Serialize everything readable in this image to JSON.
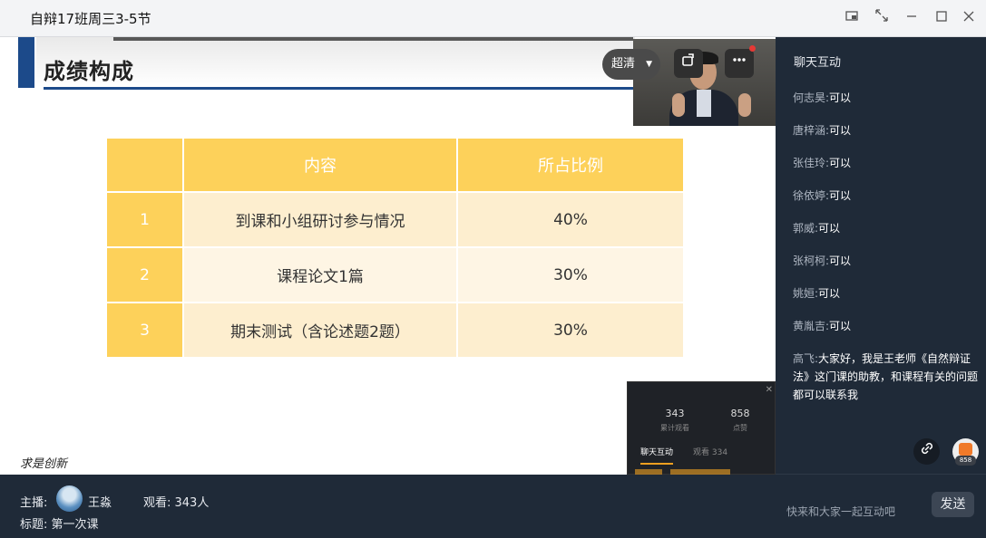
{
  "window": {
    "title": "自辩17班周三3-5节",
    "controls": [
      "pin-icon",
      "fullscreen-icon",
      "minimize-icon",
      "maximize-icon",
      "close-icon"
    ]
  },
  "slide": {
    "heading": "成绩构成",
    "table": {
      "headers": [
        "",
        "内容",
        "所占比例"
      ],
      "rows": [
        {
          "num": "1",
          "content": "到课和小组研讨参与情况",
          "ratio": "40%"
        },
        {
          "num": "2",
          "content": "课程论文1篇",
          "ratio": "30%"
        },
        {
          "num": "3",
          "content": "期末测试（含论述题2题）",
          "ratio": "30%"
        }
      ]
    },
    "signature": "求是创新",
    "colors": {
      "header": "#fdd15a",
      "row_light": "#fdeecf",
      "row_lighter": "#fef5e4",
      "accent": "#1c4a8a"
    }
  },
  "player": {
    "quality_label": "超清",
    "rotate_icon": "rotate-icon",
    "more_icon": "more-icon"
  },
  "mini_panel": {
    "stat1_value": "343",
    "stat1_label": "累计观看",
    "stat2_value": "858",
    "stat2_label": "点赞",
    "tab_chat": "聊天互动",
    "tab_viewers": "观看 334"
  },
  "info": {
    "host_label": "主播:",
    "host_name": "王淼",
    "viewers": "观看: 343人",
    "subject": "标题: 第一次课"
  },
  "chat": {
    "title": "聊天互动",
    "messages": [
      {
        "who": "何志昊:",
        "text": "可以"
      },
      {
        "who": "唐梓涵:",
        "text": "可以"
      },
      {
        "who": "张佳玲:",
        "text": "可以"
      },
      {
        "who": "徐依婷:",
        "text": "可以"
      },
      {
        "who": "郭威:",
        "text": "可以"
      },
      {
        "who": "张柯柯:",
        "text": "可以"
      },
      {
        "who": "姚姮:",
        "text": "可以"
      },
      {
        "who": "黄胤吉:",
        "text": "可以"
      },
      {
        "who": "高飞:",
        "text": "大家好，我是王老师《自然辩证法》这门课的助教，和课程有关的问题都可以联系我"
      }
    ],
    "like_count": "858",
    "input_placeholder": "快来和大家一起互动吧",
    "send_label": "发送"
  }
}
